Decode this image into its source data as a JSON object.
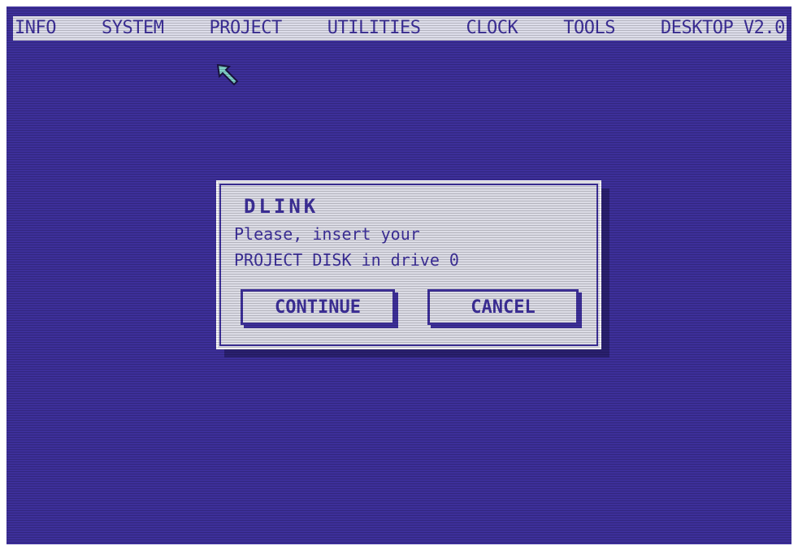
{
  "menubar": {
    "items": [
      {
        "label": "INFO"
      },
      {
        "label": "SYSTEM"
      },
      {
        "label": "PROJECT"
      },
      {
        "label": "UTILITIES"
      },
      {
        "label": "CLOCK"
      },
      {
        "label": "TOOLS"
      },
      {
        "label": "DESKTOP V2.0"
      }
    ]
  },
  "pointer": {
    "icon": "arrow-pointer-icon",
    "color": "#7fd0c8"
  },
  "dialog": {
    "title": "DLINK",
    "message_line1": "Please, insert your",
    "message_line2": "PROJECT DISK in drive 0",
    "continue_label": "CONTINUE",
    "cancel_label": "CANCEL"
  },
  "colors": {
    "background": "#3d2f9a",
    "menubar": "#ddddea",
    "dialog": "#dcdce6"
  }
}
